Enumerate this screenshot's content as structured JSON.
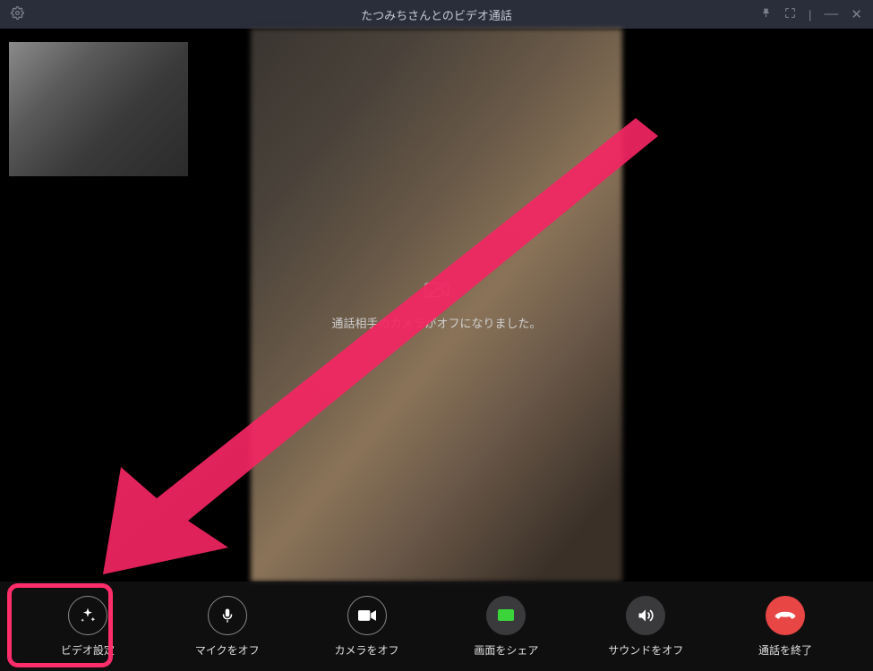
{
  "titlebar": {
    "title": "たつみちさんとのビデオ通話"
  },
  "remote": {
    "camera_off_message": "通話相手のカメラがオフになりました。"
  },
  "toolbar": {
    "video_settings": "ビデオ設定",
    "mic_off": "マイクをオフ",
    "camera_off": "カメラをオフ",
    "screen_share": "画面をシェア",
    "sound_off": "サウンドをオフ",
    "end_call": "通話を終了"
  }
}
